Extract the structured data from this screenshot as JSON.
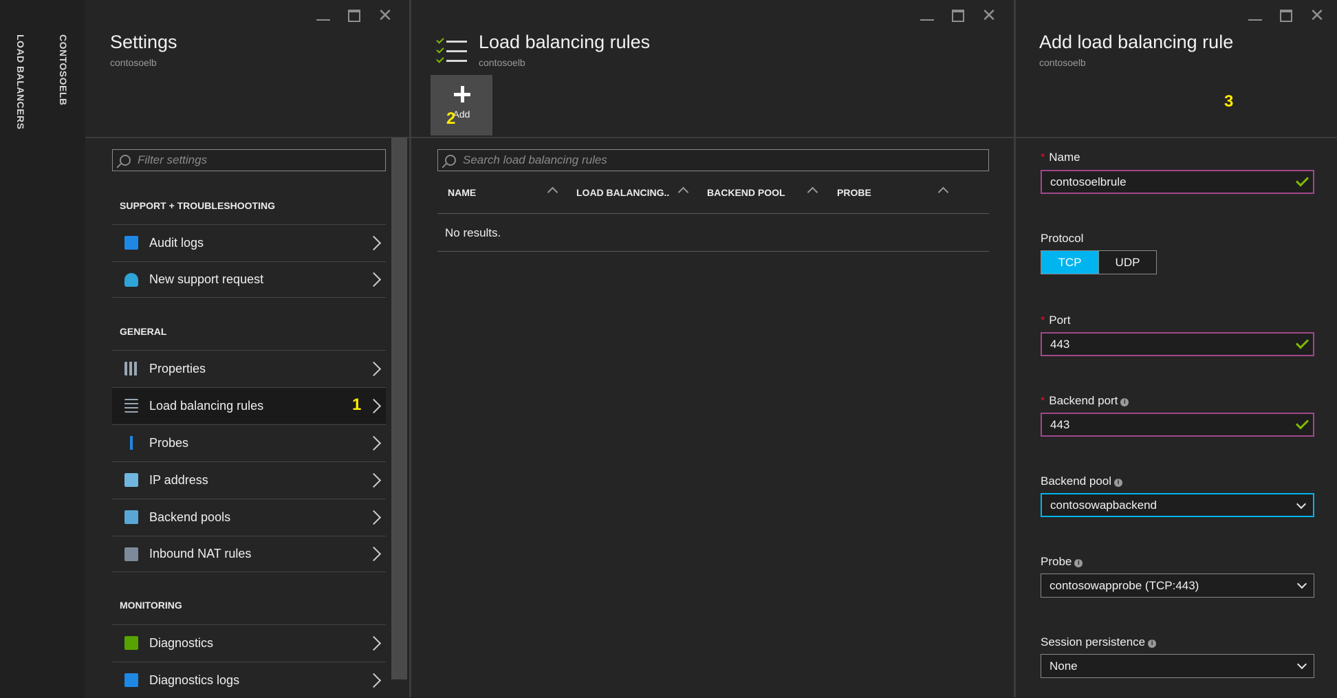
{
  "breadcrumbs": [
    "LOAD BALANCERS",
    "CONTOSOELB"
  ],
  "accent_colors": {
    "active_tab": "#f7941d",
    "annotation": "#ffeb00",
    "selected_toggle": "#00b4f0",
    "valid_check": "#7fba00",
    "required": "#e81123"
  },
  "settings_blade": {
    "title": "Settings",
    "subtitle": "contosoelb",
    "filter_placeholder": "Filter settings",
    "sections": [
      {
        "header": "SUPPORT + TROUBLESHOOTING",
        "items": [
          {
            "label": "Audit logs",
            "icon": "audit-log-icon"
          },
          {
            "label": "New support request",
            "icon": "support-person-icon"
          }
        ]
      },
      {
        "header": "GENERAL",
        "items": [
          {
            "label": "Properties",
            "icon": "properties-icon"
          },
          {
            "label": "Load balancing rules",
            "icon": "rules-list-icon"
          },
          {
            "label": "Probes",
            "icon": "probe-icon"
          },
          {
            "label": "IP address",
            "icon": "ip-address-icon"
          },
          {
            "label": "Backend pools",
            "icon": "backend-pool-icon"
          },
          {
            "label": "Inbound NAT rules",
            "icon": "nat-rules-icon"
          }
        ]
      },
      {
        "header": "MONITORING",
        "items": [
          {
            "label": "Diagnostics",
            "icon": "diagnostics-icon"
          },
          {
            "label": "Diagnostics logs",
            "icon": "diagnostics-logs-icon"
          }
        ]
      }
    ]
  },
  "rules_blade": {
    "title": "Load balancing rules",
    "subtitle": "contosoelb",
    "add_label": "Add",
    "search_placeholder": "Search load balancing rules",
    "columns": [
      "NAME",
      "LOAD BALANCING..",
      "BACKEND POOL",
      "PROBE"
    ],
    "empty_text": "No results."
  },
  "add_blade": {
    "title": "Add load balancing rule",
    "subtitle": "contosoelb",
    "name_label": "Name",
    "name_value": "contosoelbrule",
    "protocol_label": "Protocol",
    "protocol_options": [
      "TCP",
      "UDP"
    ],
    "protocol_selected": "TCP",
    "port_label": "Port",
    "port_value": "443",
    "backend_port_label": "Backend port",
    "backend_port_value": "443",
    "backend_pool_label": "Backend pool",
    "backend_pool_value": "contosowapbackend",
    "probe_label": "Probe",
    "probe_value": "contosowapprobe (TCP:443)",
    "session_label": "Session persistence",
    "session_value": "None"
  },
  "annotations": [
    "1",
    "2",
    "3"
  ]
}
